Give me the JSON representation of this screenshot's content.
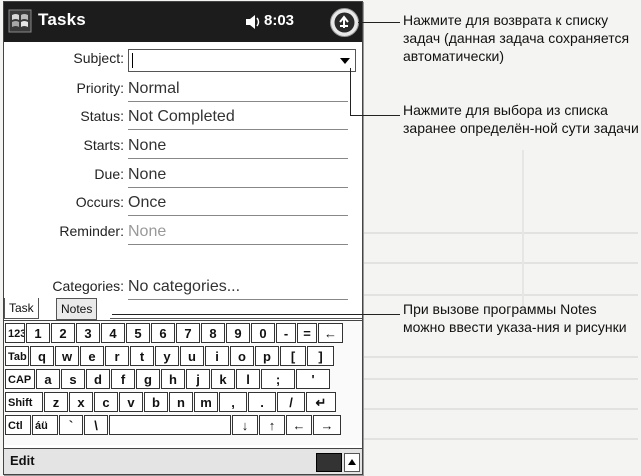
{
  "titlebar": {
    "app_title": "Tasks",
    "clock": "8:03",
    "icons": [
      "start-menu-icon",
      "speaker-icon",
      "ok-icon"
    ]
  },
  "form": {
    "fields": [
      {
        "label": "Subject:",
        "value": ""
      },
      {
        "label": "Priority:",
        "value": "Normal"
      },
      {
        "label": "Status:",
        "value": "Not Completed"
      },
      {
        "label": "Starts:",
        "value": "None"
      },
      {
        "label": "Due:",
        "value": "None"
      },
      {
        "label": "Occurs:",
        "value": "Once"
      },
      {
        "label": "Reminder:",
        "value": "None"
      }
    ],
    "categories": {
      "label": "Categories:",
      "value": "No categories..."
    }
  },
  "tabs": [
    {
      "label": "Task",
      "active": true
    },
    {
      "label": "Notes",
      "active": false
    }
  ],
  "keyboard": {
    "rows": [
      [
        "123",
        "1",
        "2",
        "3",
        "4",
        "5",
        "6",
        "7",
        "8",
        "9",
        "0",
        "-",
        "=",
        "←"
      ],
      [
        "Tab",
        "q",
        "w",
        "e",
        "r",
        "t",
        "y",
        "u",
        "i",
        "o",
        "p",
        "[",
        "]"
      ],
      [
        "CAP",
        "a",
        "s",
        "d",
        "f",
        "g",
        "h",
        "j",
        "k",
        "l",
        ";",
        "'"
      ],
      [
        "Shift",
        "z",
        "x",
        "c",
        "v",
        "b",
        "n",
        "m",
        ",",
        ".",
        "/",
        "↵"
      ],
      [
        "Ctl",
        "áü",
        "`",
        "\\",
        "",
        "↓",
        "↑",
        "←",
        "→"
      ]
    ]
  },
  "menubar": {
    "edit_label": "Edit"
  },
  "callouts": [
    "Нажмите для возврата к списку задач (данная задача сохраняется автоматически)",
    "Нажмите для выбора из списка заранее определён-ной сути задачи",
    "При вызове программы Notes можно ввести указа-ния и рисунки"
  ]
}
